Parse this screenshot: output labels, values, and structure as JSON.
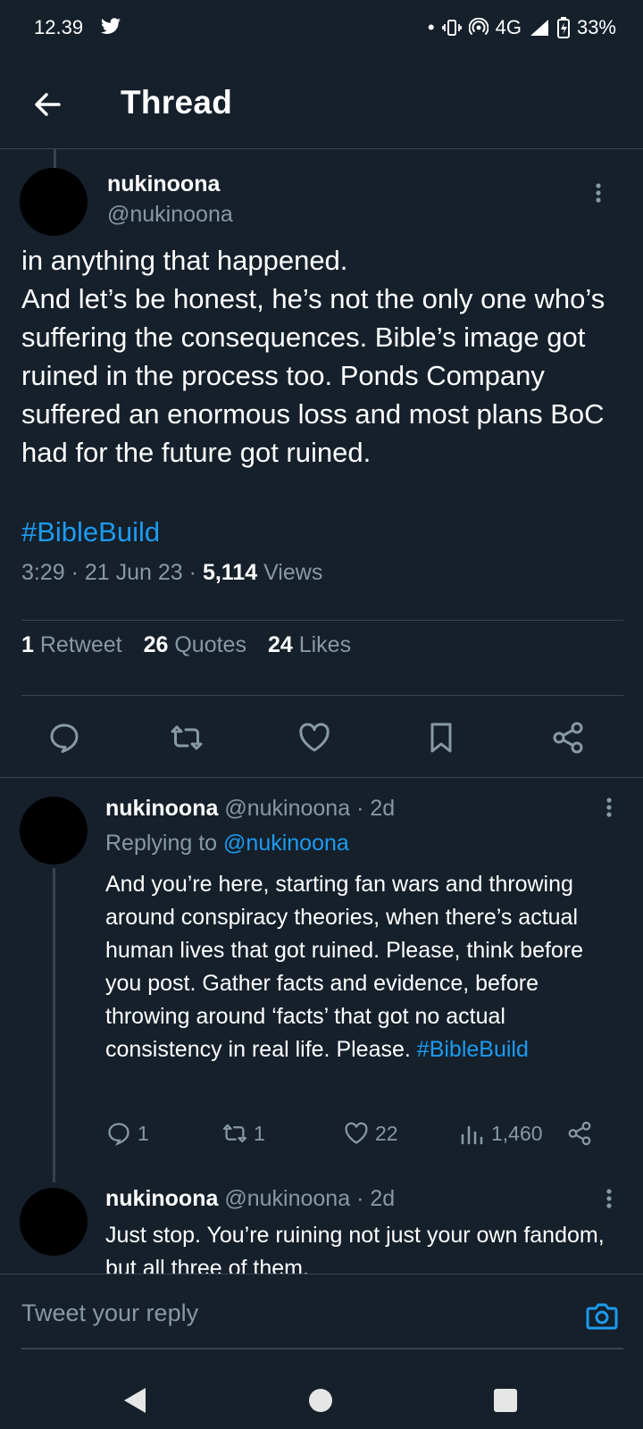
{
  "status_bar": {
    "time": "12.39",
    "network": "4G",
    "battery": "33%"
  },
  "header": {
    "title": "Thread"
  },
  "main_tweet": {
    "name": "nukinoona",
    "handle": "@nukinoona",
    "text": "in anything that happened.\nAnd let’s be honest, he’s not the only one who’s suffering the consequences. Bible’s image got ruined in the process too. Ponds Company suffered an enormous loss and most plans BoC had for the future got ruined.",
    "hashtag": "#BibleBuild",
    "time": "3:29",
    "date": "21 Jun 23",
    "views_count": "5,114",
    "views_label": "Views",
    "stats": {
      "retweets_count": "1",
      "retweets_label": "Retweet",
      "quotes_count": "26",
      "quotes_label": "Quotes",
      "likes_count": "24",
      "likes_label": "Likes"
    }
  },
  "reply1": {
    "name": "nukinoona",
    "handle": "@nukinoona",
    "age": "2d",
    "replying_prefix": "Replying to",
    "replying_to": "@nukinoona",
    "text": "And you’re here, starting fan wars and throwing around conspiracy theories, when there’s actual human lives that got ruined. Please, think before you post. Gather facts and evidence, before throwing around ‘facts’ that got no actual consistency in real life. Please.",
    "hashtag": "#BibleBuild",
    "replies": "1",
    "retweets": "1",
    "likes": "22",
    "views": "1,460"
  },
  "reply2": {
    "name": "nukinoona",
    "handle": "@nukinoona",
    "age": "2d",
    "text": "Just stop. You’re ruining not just your own fandom, but all three of them."
  },
  "reply_bar": {
    "placeholder": "Tweet your reply"
  },
  "colors": {
    "background": "#15202b",
    "accent": "#1d9bf0",
    "muted": "#8899a6",
    "divider": "#38444d"
  }
}
